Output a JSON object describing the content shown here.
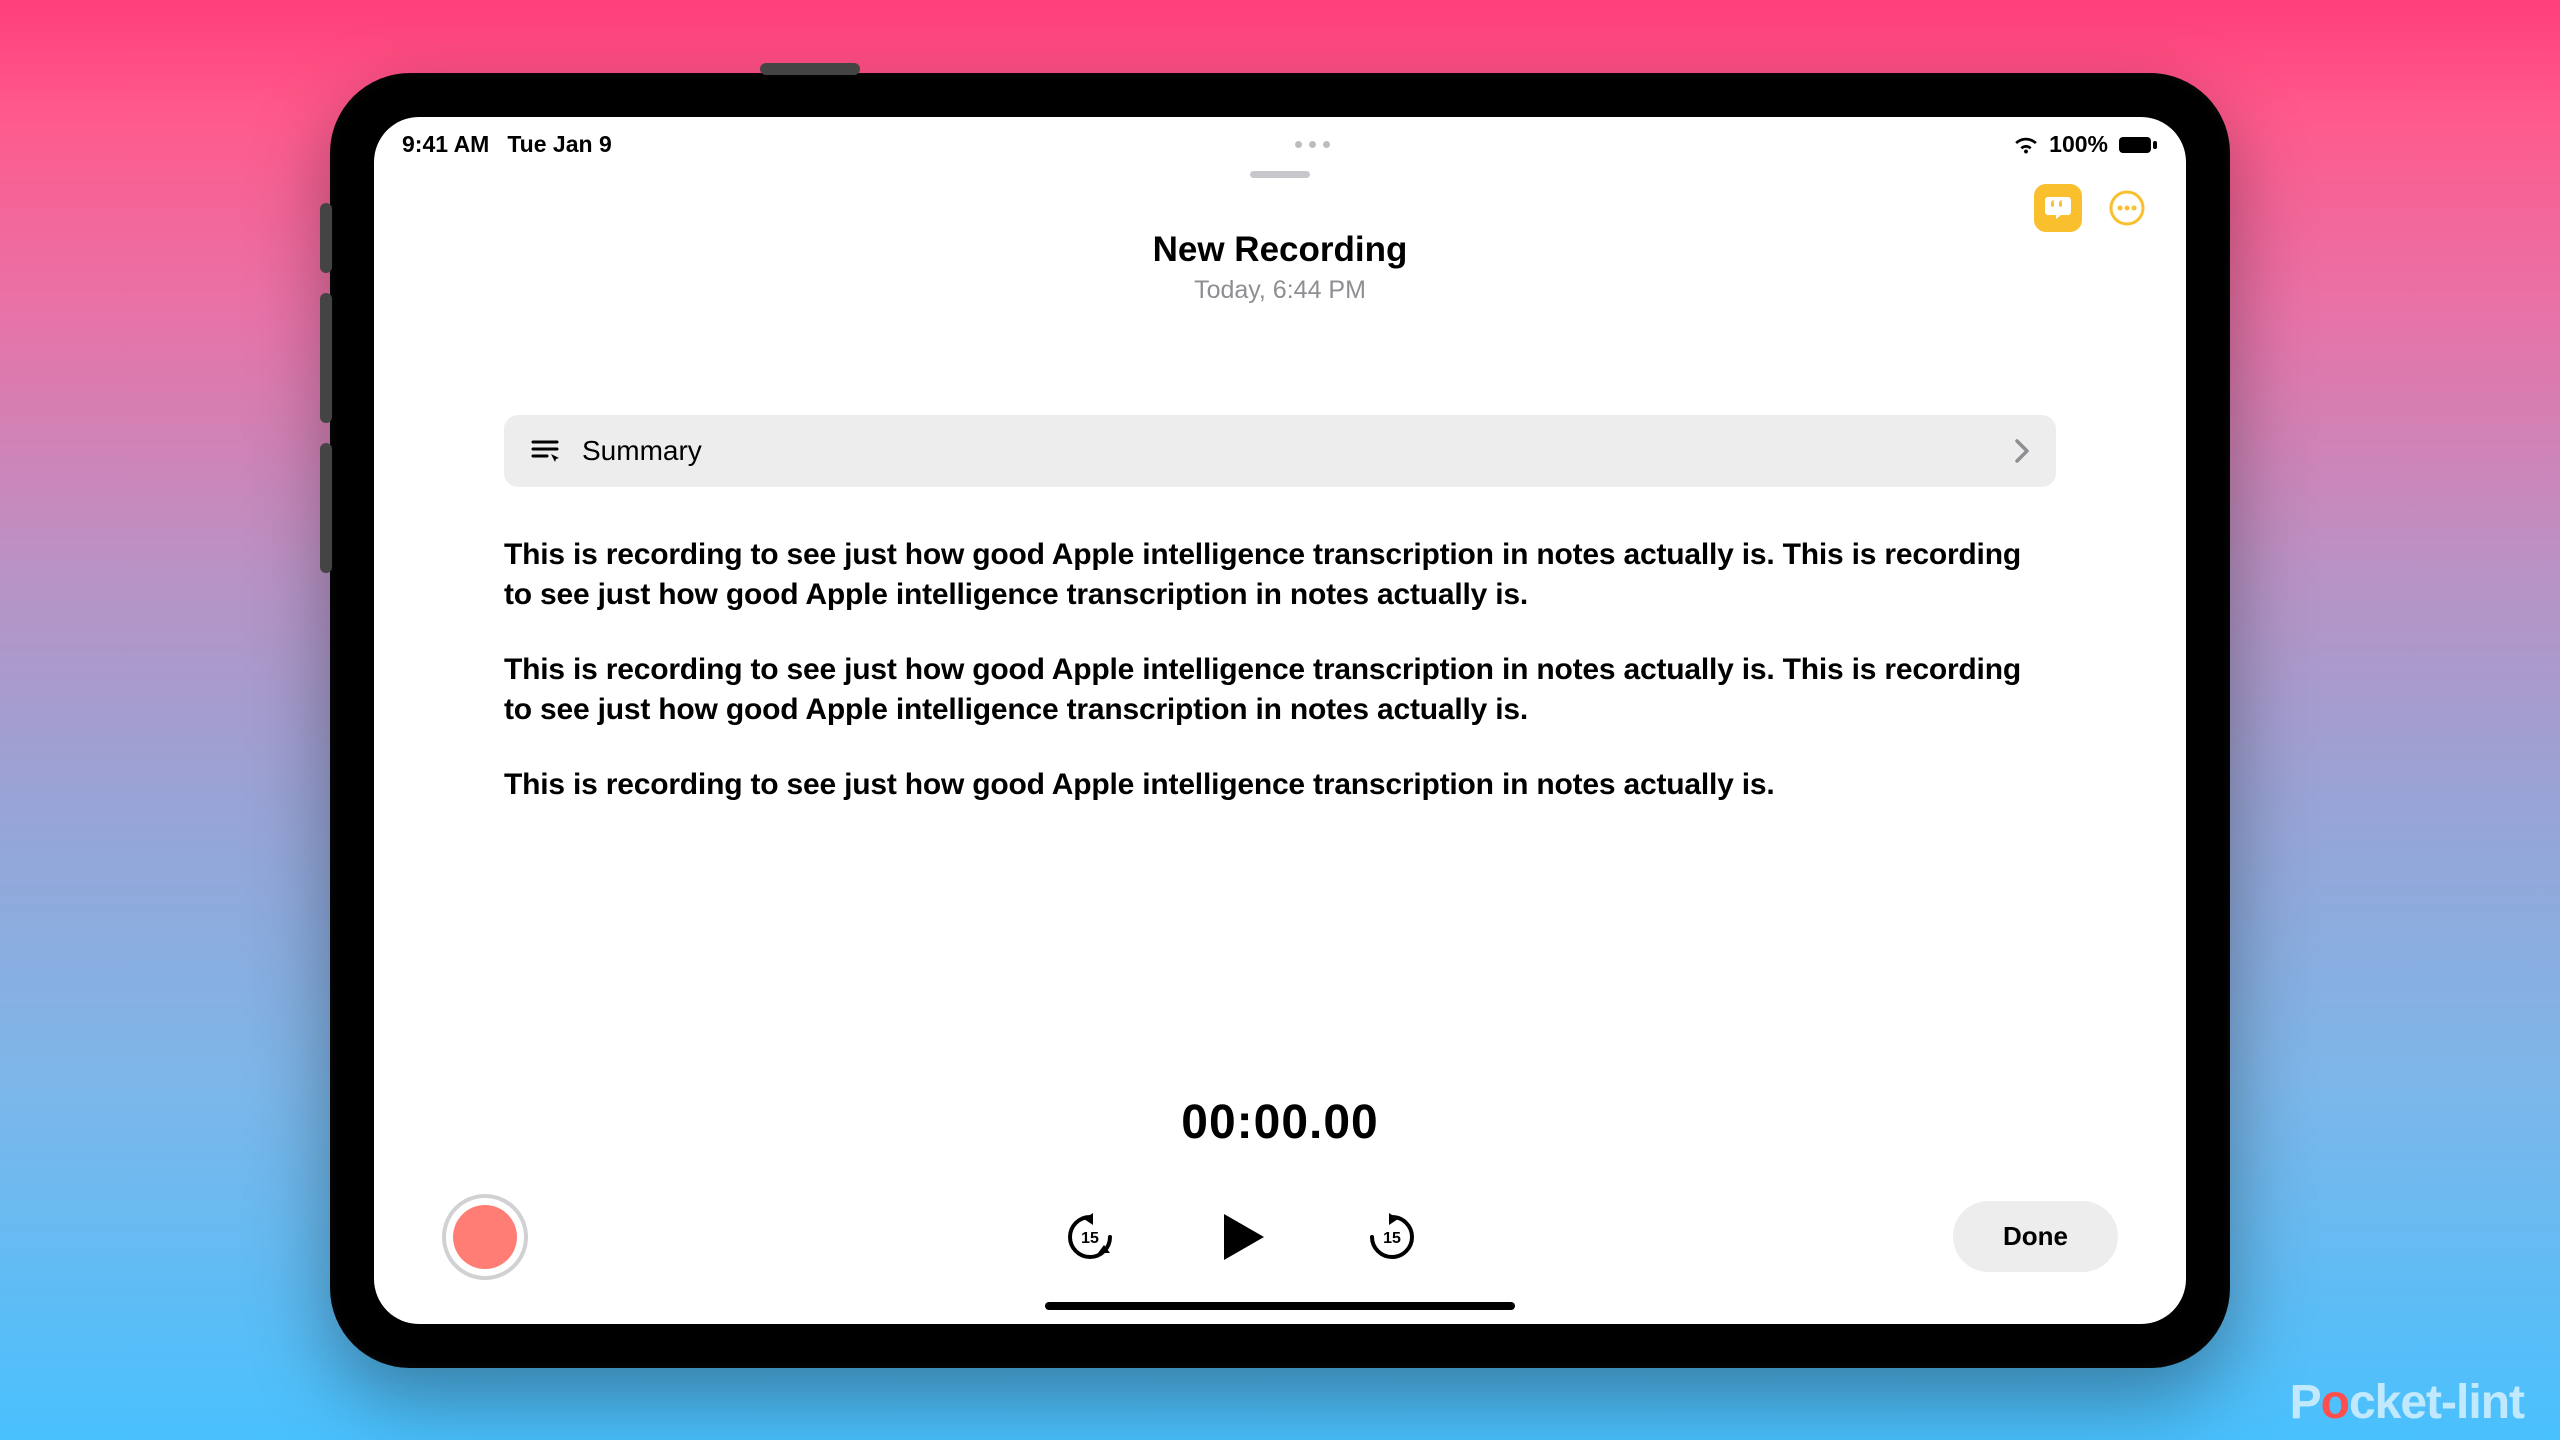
{
  "status": {
    "time": "9:41 AM",
    "date": "Tue Jan 9",
    "battery_pct": "100%"
  },
  "header": {
    "title": "New Recording",
    "subtitle": "Today, 6:44 PM"
  },
  "summary": {
    "label": "Summary"
  },
  "transcript": {
    "p1": "This is recording to see just how good Apple intelligence transcription in notes actually is. This is recording to see just how good Apple intelligence transcription in notes actually is.",
    "p2": "This is recording to see just how good Apple intelligence transcription in notes actually is. This is recording to see just how good Apple intelligence transcription in notes actually is.",
    "p3": "This is recording to see just how good Apple intelligence transcription in notes actually is."
  },
  "player": {
    "time": "00:00.00",
    "skip_seconds": "15",
    "done_label": "Done"
  },
  "watermark": {
    "prefix": "P",
    "o": "o",
    "suffix": "cket-lint"
  }
}
